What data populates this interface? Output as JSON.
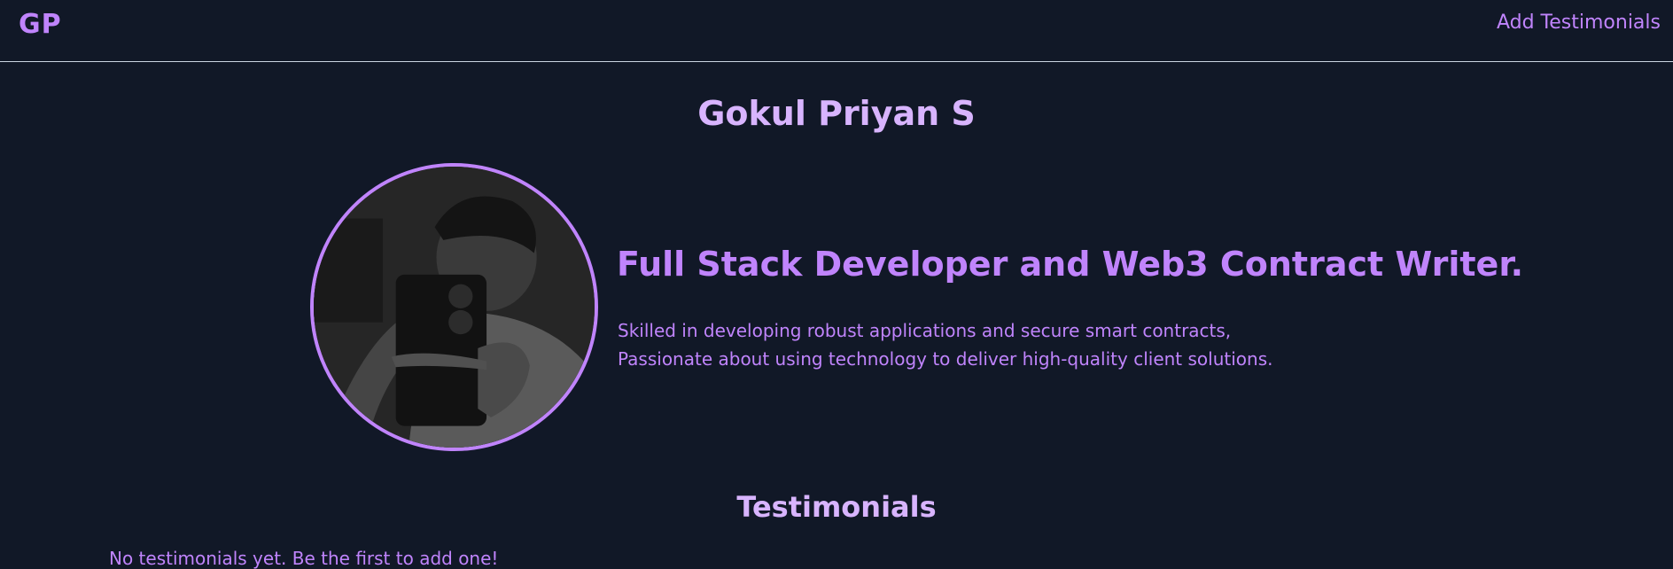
{
  "header": {
    "logo": "GP",
    "nav_link": "Add Testimonials"
  },
  "profile": {
    "name": "Gokul Priyan S",
    "avatar_icon": "profile-photo",
    "headline": "Full Stack Developer and Web3 Contract Writer.",
    "tagline_line1": "Skilled in developing robust applications and secure smart contracts,",
    "tagline_line2": "Passionate about using technology to deliver high-quality client solutions."
  },
  "testimonials": {
    "title": "Testimonials",
    "empty_message": "No testimonials yet. Be the first to add one!"
  },
  "colors": {
    "background": "#111827",
    "accent": "#c084fc",
    "heading": "#d8b4fe",
    "divider": "#cbd5e1"
  }
}
